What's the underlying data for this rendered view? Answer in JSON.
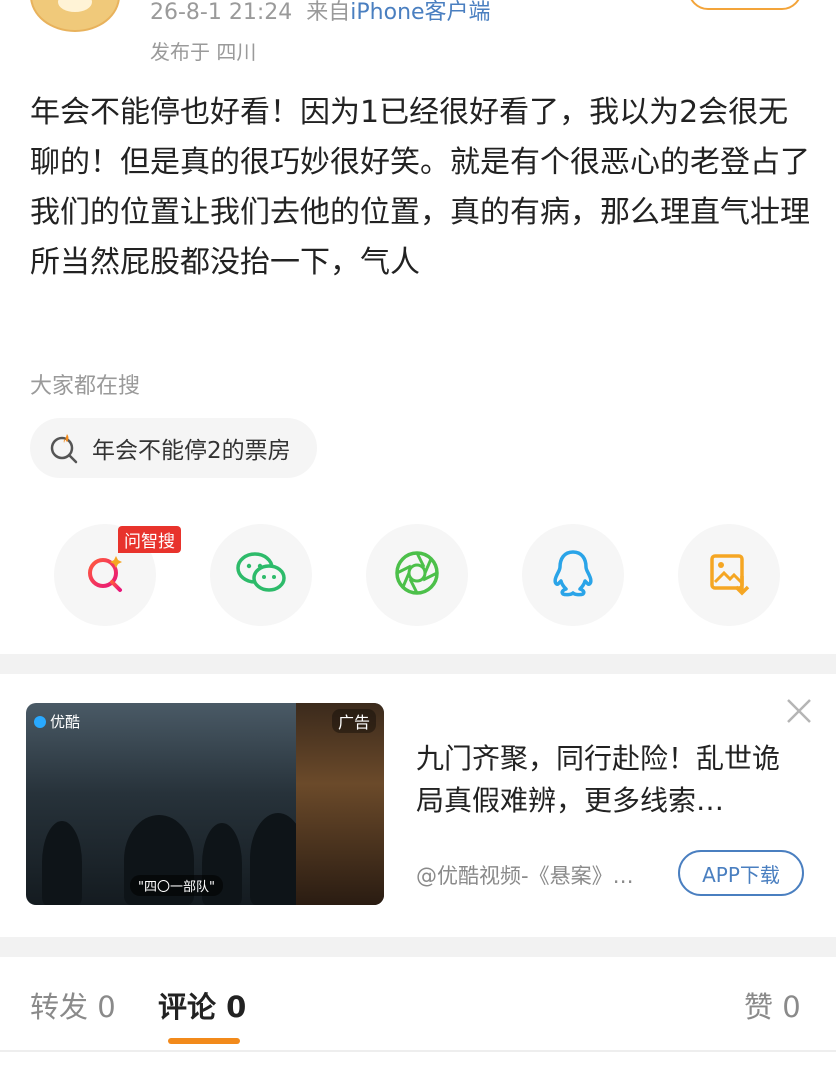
{
  "header": {
    "timestamp": "26-8-1 21:24",
    "source_prefix": "来自",
    "source": "iPhone客户端",
    "location": "发布于 四川"
  },
  "post": {
    "text": "年会不能停也好看！因为1已经很好看了，我以为2会很无聊的！但是真的很巧妙很好笑。就是有个很恶心的老登占了我们的位置让我们去他的位置，真的有病，那么理直气壮理所当然屁股都没抬一下，气人"
  },
  "search": {
    "title": "大家都在搜",
    "chip": "年会不能停2的票房"
  },
  "share": {
    "badge": "问智搜",
    "icons": [
      "ai-search-icon",
      "wechat-icon",
      "moments-icon",
      "qq-icon",
      "save-image-icon"
    ]
  },
  "ad": {
    "brand": "优酷",
    "tag": "广告",
    "caption": "\"四〇一部队\"",
    "headline": "九门齐聚，同行赴险！乱世诡局真假难辨，更多线索…",
    "source": "@优酷视频-《悬案》…",
    "cta": "APP下载"
  },
  "tabs": {
    "repost": "转发 0",
    "comment": "评论 0",
    "like": "赞 0"
  },
  "colors": {
    "accent_orange": "#f28a1b",
    "link_blue": "#4a7fc0",
    "badge_red": "#e8332c",
    "wechat_green": "#2dbb6a",
    "qq_blue": "#2aa4e8"
  }
}
